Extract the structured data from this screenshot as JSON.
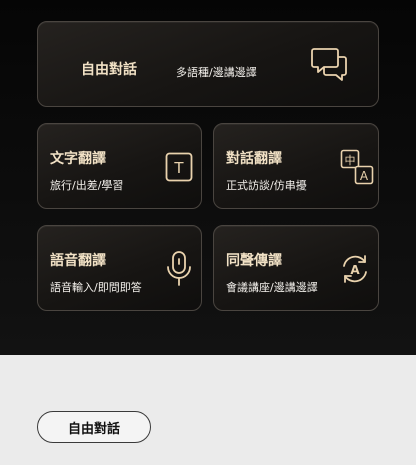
{
  "cards": {
    "free_talk": {
      "title": "自由對話",
      "subtitle": "多語種/邊講邊譯",
      "icon": "chat-bubbles-icon"
    },
    "text": {
      "title": "文字翻譯",
      "subtitle": "旅行/出差/學習",
      "icon": "text-t-icon"
    },
    "dialogue": {
      "title": "對話翻譯",
      "subtitle": "正式訪談/仿串擾",
      "icon": "translate-zh-a-icon"
    },
    "voice": {
      "title": "語音翻譯",
      "subtitle": "語音輸入/即問即答",
      "icon": "microphone-icon"
    },
    "simultaneous": {
      "title": "同聲傳譯",
      "subtitle": "會議講座/邊講邊譯",
      "icon": "refresh-a-icon"
    }
  },
  "icon_glyphs": {
    "chinese": "中",
    "latin": "A",
    "t": "T"
  },
  "bottom_button": {
    "label": "自由對話"
  },
  "colors": {
    "gold": "#e9d2ad",
    "dark_bg": "#0b0b0b",
    "light_bg": "#ebebeb"
  }
}
